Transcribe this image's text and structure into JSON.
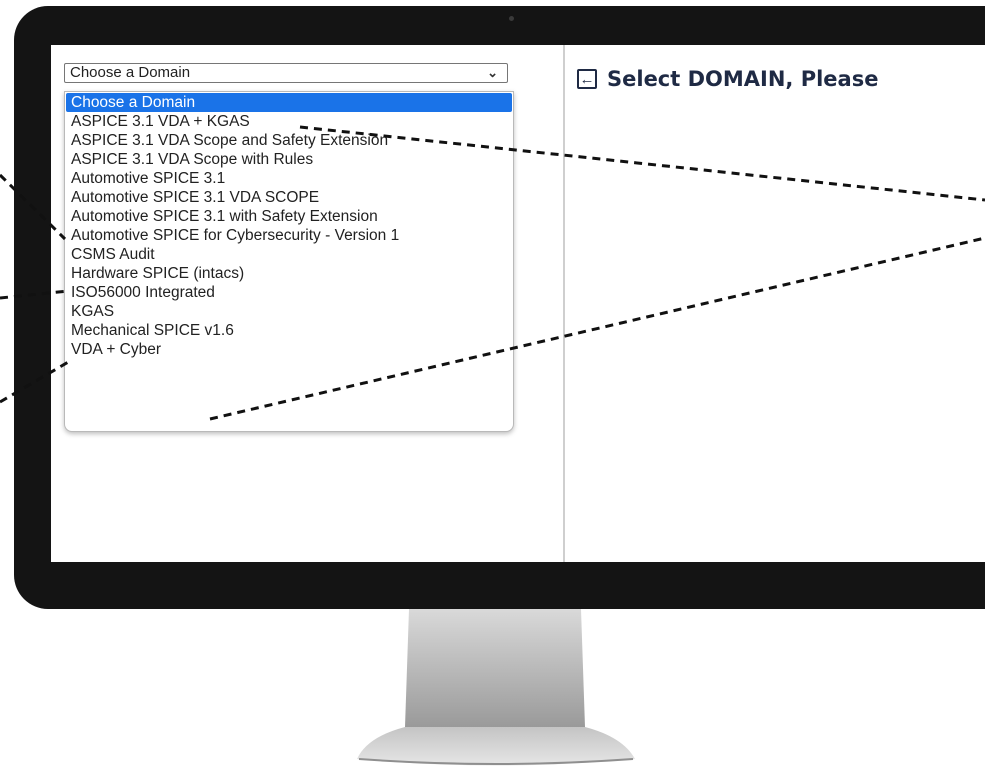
{
  "select": {
    "value": "Choose a Domain",
    "chevron_icon": "chevron-down-icon"
  },
  "dropdown": {
    "options": [
      {
        "label": "Choose a Domain",
        "selected": true
      },
      {
        "label": "ASPICE 3.1 VDA + KGAS"
      },
      {
        "label": "ASPICE 3.1 VDA Scope and Safety Extension"
      },
      {
        "label": "ASPICE 3.1 VDA Scope with Rules"
      },
      {
        "label": "Automotive SPICE 3.1"
      },
      {
        "label": "Automotive SPICE 3.1 VDA SCOPE"
      },
      {
        "label": "Automotive SPICE 3.1 with Safety Extension"
      },
      {
        "label": "Automotive SPICE for Cybersecurity - Version 1"
      },
      {
        "label": "CSMS Audit"
      },
      {
        "label": "Hardware SPICE (intacs)"
      },
      {
        "label": "ISO56000 Integrated"
      },
      {
        "label": "KGAS"
      },
      {
        "label": "Mechanical SPICE v1.6"
      },
      {
        "label": "VDA + Cyber"
      }
    ]
  },
  "header": {
    "title": "Select DOMAIN, Please",
    "back_icon": "arrow-left-icon"
  },
  "colors": {
    "accent": "#1a73e8",
    "title_text": "#1f2a44",
    "bezel": "#141414"
  }
}
